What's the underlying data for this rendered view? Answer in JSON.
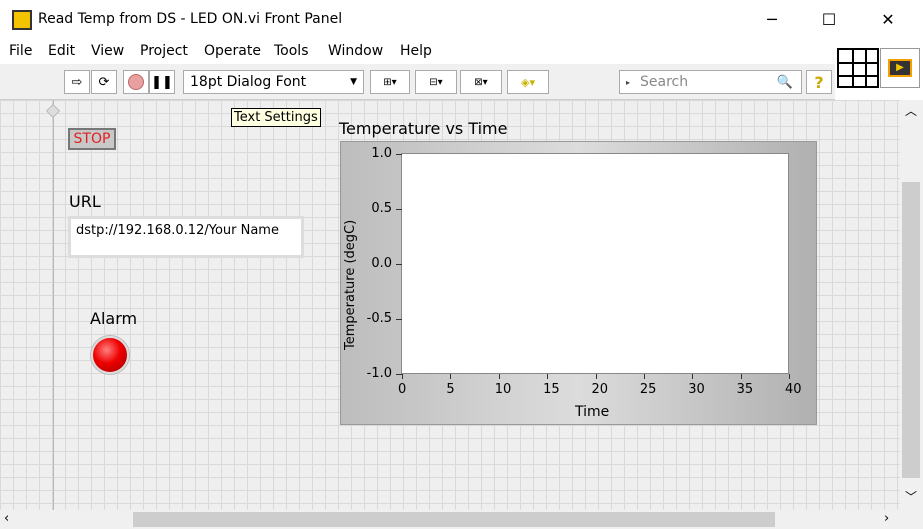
{
  "window": {
    "title": "Read Temp from DS - LED ON.vi Front Panel",
    "minimize": "─",
    "maximize": "☐",
    "close": "✕"
  },
  "menu": [
    "File",
    "Edit",
    "View",
    "Project",
    "Operate",
    "Tools",
    "Window",
    "Help"
  ],
  "toolbar": {
    "font_select": "18pt Dialog Font",
    "search_placeholder": "Search",
    "help": "?",
    "tooltip": "Text Settings"
  },
  "panel": {
    "stop_label": "STOP",
    "url_label": "URL",
    "url_value": "dstp://192.168.0.12/Your Name",
    "alarm_label": "Alarm",
    "alarm_color": "#ee0000",
    "alarm_on": true
  },
  "chart_data": {
    "type": "line",
    "title": "Temperature vs Time",
    "xlabel": "Time",
    "ylabel": "Temperature (degC)",
    "xlim": [
      0,
      40
    ],
    "ylim": [
      -1,
      1
    ],
    "xticks": [
      "0",
      "5",
      "10",
      "15",
      "20",
      "25",
      "30",
      "35",
      "40"
    ],
    "yticks": [
      "1.0",
      "0.5",
      "0.0",
      "-0.5",
      "-1.0"
    ],
    "series": []
  }
}
